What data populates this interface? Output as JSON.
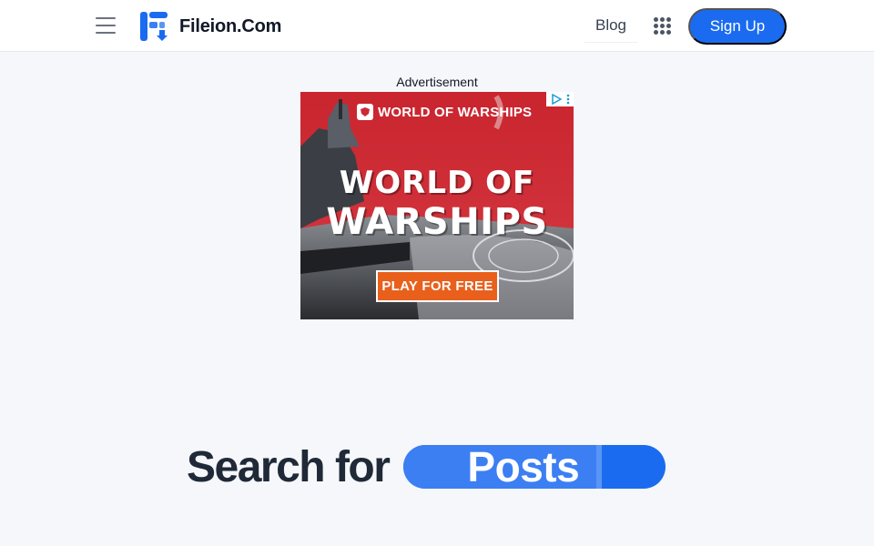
{
  "header": {
    "brand_name": "Fileion.Com",
    "nav_blog": "Blog",
    "signup_label": "Sign Up",
    "menu_icon": "hamburger-menu-icon",
    "apps_icon": "grid-dots-icon",
    "accent_color": "#1a6bf0"
  },
  "ad": {
    "label": "Advertisement",
    "brand": "WORLD OF WARSHIPS",
    "title_line1": "WORLD OF",
    "title_line2": "WARSHIPS",
    "cta": "PLAY FOR FREE",
    "background_color": "#cc2a36",
    "cta_color": "#e8601c"
  },
  "hero": {
    "prefix": "Search for",
    "highlight": "Posts"
  }
}
